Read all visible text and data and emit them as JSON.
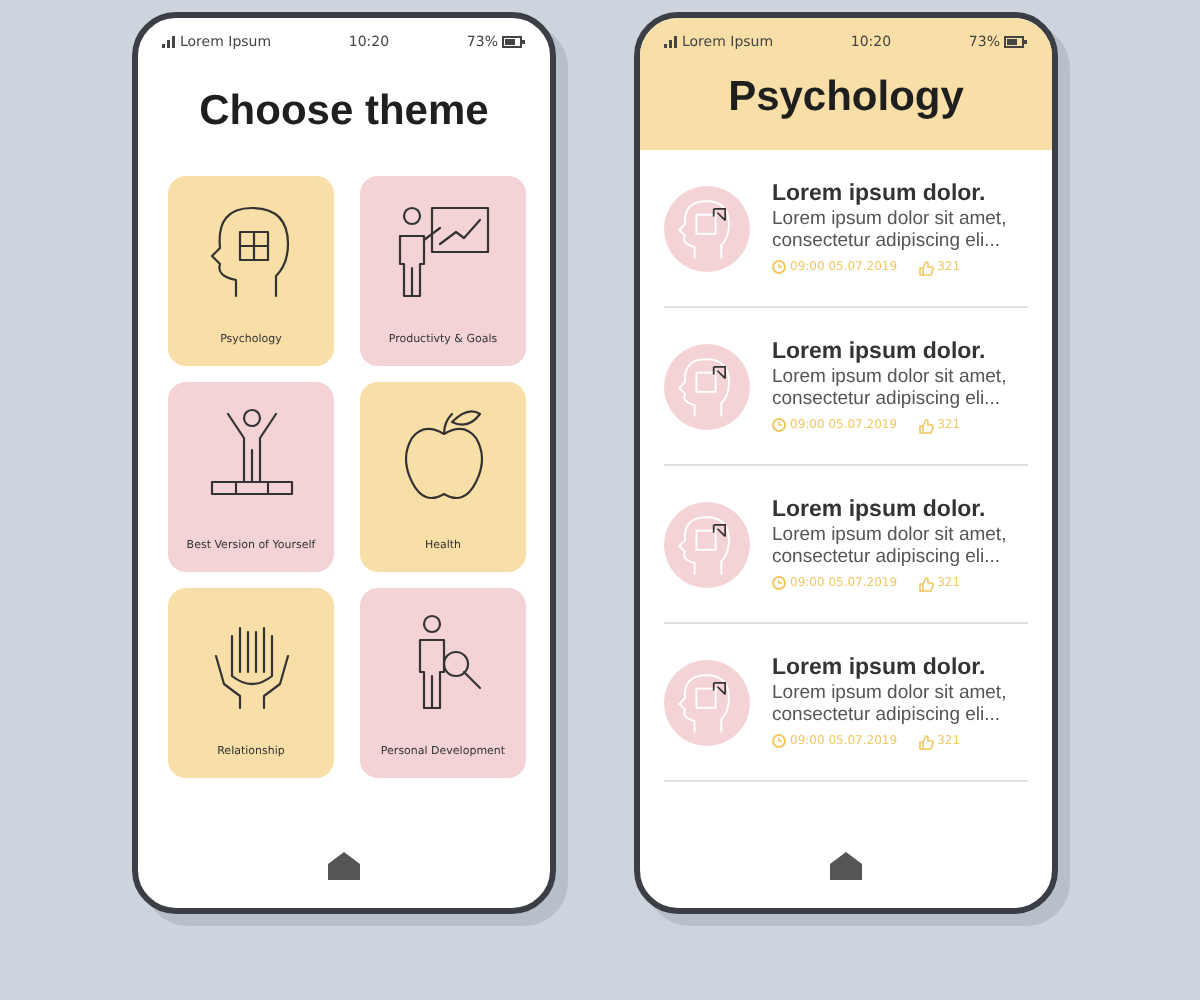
{
  "screens": [
    {
      "status": {
        "carrier": "Lorem Ipsum",
        "time": "10:20",
        "battery": "73%"
      },
      "title": "Choose theme",
      "themes": [
        {
          "label": "Psychology",
          "color": "#f8dfa8"
        },
        {
          "label": "Productivty & Goals",
          "color": "#f3d3d6"
        },
        {
          "label": "Best Version of Yourself",
          "color": "#f3d3d6"
        },
        {
          "label": "Health",
          "color": "#f8dfa8"
        },
        {
          "label": "Relationship",
          "color": "#f8dfa8"
        },
        {
          "label": "Personal Development",
          "color": "#f3d3d6"
        }
      ]
    },
    {
      "status": {
        "carrier": "Lorem Ipsum",
        "time": "10:20",
        "battery": "73%"
      },
      "title": "Psychology",
      "articles": [
        {
          "title": "Lorem ipsum dolor.",
          "text": "Lorem ipsum dolor sit amet, consectetur adipiscing eli...",
          "date": "09:00 05.07.2019",
          "likes": "321"
        },
        {
          "title": "Lorem ipsum dolor.",
          "text": "Lorem ipsum dolor sit amet, consectetur adipiscing eli...",
          "date": "09:00 05.07.2019",
          "likes": "321"
        },
        {
          "title": "Lorem ipsum dolor.",
          "text": "Lorem ipsum dolor sit amet, consectetur adipiscing eli...",
          "date": "09:00 05.07.2019",
          "likes": "321"
        },
        {
          "title": "Lorem ipsum dolor.",
          "text": "Lorem ipsum dolor sit amet, consectetur adipiscing eli...",
          "date": "09:00 05.07.2019",
          "likes": "321"
        }
      ]
    }
  ]
}
